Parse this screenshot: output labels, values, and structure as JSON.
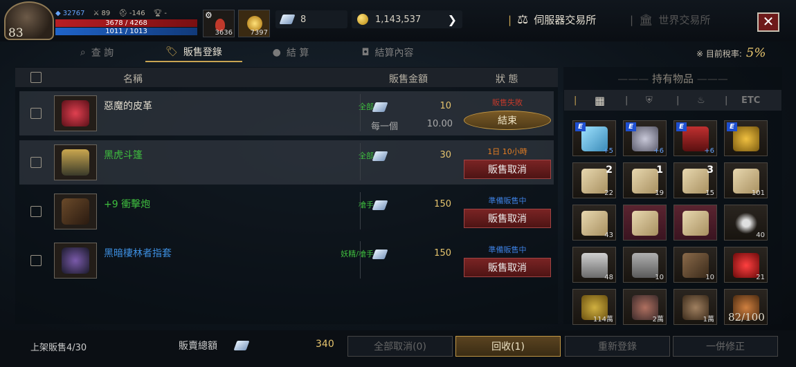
{
  "player": {
    "level": "83",
    "stat1": "32767",
    "stat2": "89",
    "stat3": "-146",
    "stat4": "-",
    "hp": "3678 / 4268",
    "mp": "1011 / 1013"
  },
  "quick_slots": [
    {
      "count": "3636"
    },
    {
      "count": "7397"
    }
  ],
  "currency": {
    "gems": "8",
    "gold": "1,143,537"
  },
  "nav": {
    "server_exchange": "伺服器交易所",
    "world_exchange": "世界交易所",
    "close": "✕"
  },
  "tabs": [
    {
      "label": "查 詢"
    },
    {
      "label": "販售登錄"
    },
    {
      "label": "結 算"
    },
    {
      "label": "結算內容"
    }
  ],
  "tax": {
    "label": "※ 目前稅率:",
    "value": "5%"
  },
  "table_header": {
    "name": "名稱",
    "price": "販售金額",
    "status": "狀 態"
  },
  "rows": [
    {
      "name": "惡魔的皮革",
      "name_color": "#e0dacc",
      "category": "全部",
      "price": "10",
      "unit_label": "每一個",
      "unit_price": "10.00",
      "status": "販售失敗",
      "status_color": "#c0392b",
      "button": "結束"
    },
    {
      "name": "黑虎斗篷",
      "name_color": "#3fbf3f",
      "category": "全部",
      "price": "30",
      "status": "1日 10小時",
      "status_color": "#e67e22",
      "button": "販售取消"
    },
    {
      "name": "+9 衝擊炮",
      "name_color": "#3fbf3f",
      "category": "槍手",
      "price": "150",
      "status": "準備販售中",
      "status_color": "#3d7fe0",
      "button": "販售取消"
    },
    {
      "name": "黑暗棲林者指套",
      "name_color": "#3d8fe0",
      "category": "妖精/槍手",
      "price": "150",
      "status": "準備販售中",
      "status_color": "#3d7fe0",
      "button": "販售取消"
    }
  ],
  "inventory": {
    "title": "持有物品",
    "filter_etc": "ETC",
    "capacity": "82/100",
    "items": [
      {
        "count": "+5",
        "enhanced": "E"
      },
      {
        "count": "+6",
        "enhanced": "E"
      },
      {
        "count": "+6",
        "enhanced": "E"
      },
      {
        "count": "",
        "enhanced": "E"
      },
      {
        "count": "22",
        "tier": "2"
      },
      {
        "count": "19",
        "tier": "1"
      },
      {
        "count": "15",
        "tier": "3"
      },
      {
        "count": "101"
      },
      {
        "count": "43"
      },
      {
        "count": ""
      },
      {
        "count": ""
      },
      {
        "count": "40"
      },
      {
        "count": "48"
      },
      {
        "count": "10"
      },
      {
        "count": "10"
      },
      {
        "count": "21"
      },
      {
        "count": "114萬"
      },
      {
        "count": "2萬"
      },
      {
        "count": "1萬"
      },
      {
        "count": ""
      }
    ]
  },
  "footer": {
    "listing": "上架販售4/30",
    "total_label": "販賣總額",
    "total": "340",
    "cancel_all": "全部取消(0)",
    "reclaim": "回收(1)",
    "relist": "重新登錄",
    "batch_edit": "一併修正"
  }
}
